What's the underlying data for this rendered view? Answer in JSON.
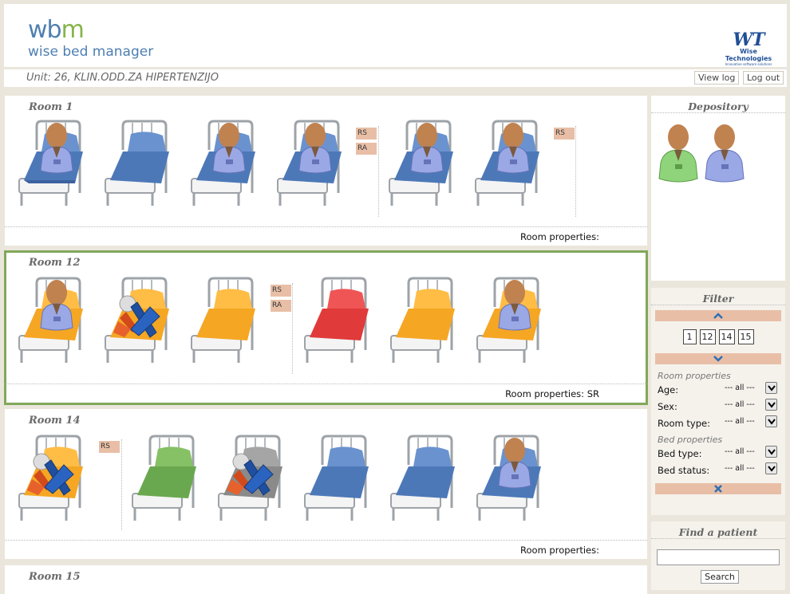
{
  "app": {
    "logo_short_wb": "wb",
    "logo_short_m": "m",
    "logo_name": "wise bed manager",
    "company_short": "WT",
    "company_name": "Wise Technologies",
    "company_tagline": "Innovative software solutions"
  },
  "unit": {
    "title": "Unit: 26, KLIN.ODD.ZA HIPERTENZIJO",
    "view_log_label": "View log",
    "log_out_label": "Log out"
  },
  "colors": {
    "blue_bed": "#4d78b8",
    "orange_bed": "#f5a623",
    "red_bed": "#e03a3a",
    "green_bed": "#6aa84f",
    "gray_bed": "#8a8a8a",
    "tag_bg": "#e8bfa6",
    "selected_outline": "#80a85a"
  },
  "rooms": [
    {
      "title": "Room 1",
      "properties_label": "Room properties:",
      "tags": [
        "RS",
        "RA",
        "RS"
      ]
    },
    {
      "title": "Room 12",
      "properties_label": "Room properties: SR",
      "tags": [
        "RS",
        "RA"
      ]
    },
    {
      "title": "Room 14",
      "properties_label": "Room properties:",
      "tags": [
        "RS"
      ]
    },
    {
      "title": "Room 15"
    }
  ],
  "depository": {
    "title": "Depository",
    "patients": [
      "green-patient-icon",
      "blue-patient-icon"
    ]
  },
  "filter": {
    "title": "Filter",
    "rooms": [
      "1",
      "12",
      "14",
      "15"
    ],
    "room_properties_heading": "Room properties",
    "bed_properties_heading": "Bed properties",
    "age_label": "Age:",
    "sex_label": "Sex:",
    "room_type_label": "Room type:",
    "bed_type_label": "Bed type:",
    "bed_status_label": "Bed status:",
    "all_option": "--- all ---"
  },
  "find": {
    "title": "Find a patient",
    "value": "",
    "search_label": "Search"
  }
}
